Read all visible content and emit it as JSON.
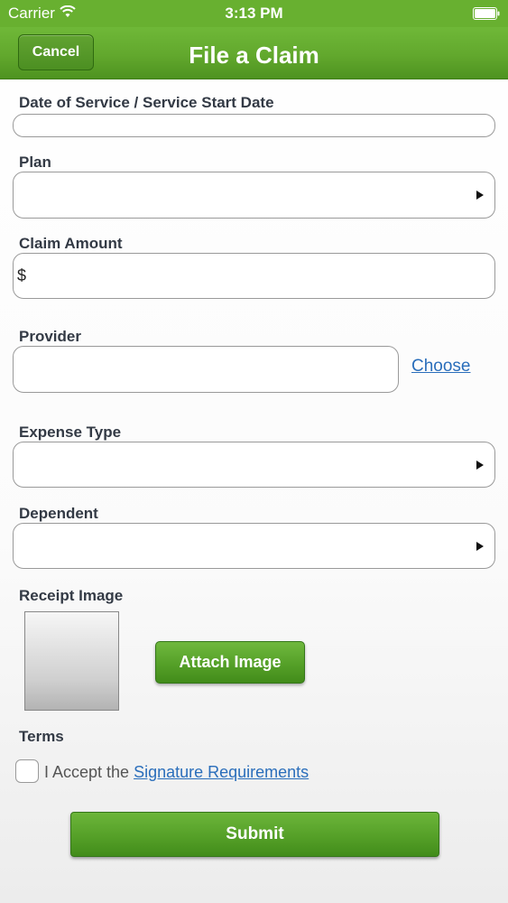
{
  "status_bar": {
    "carrier": "Carrier",
    "time": "3:13 PM",
    "wifi_icon": "wifi-icon",
    "battery_icon": "battery-icon"
  },
  "nav": {
    "cancel_label": "Cancel",
    "title": "File a Claim"
  },
  "form": {
    "date_label": "Date of Service / Service Start Date",
    "date_value": "",
    "plan_label": "Plan",
    "plan_value": "",
    "amount_label": "Claim Amount",
    "amount_prefix": "$",
    "amount_value": "",
    "provider_label": "Provider",
    "provider_value": "",
    "choose_label": "Choose",
    "expense_type_label": "Expense Type",
    "expense_type_value": "",
    "dependent_label": "Dependent",
    "dependent_value": "",
    "receipt_label": "Receipt Image",
    "attach_label": "Attach Image",
    "terms_label": "Terms",
    "terms_prefix": "I Accept the ",
    "terms_link": "Signature Requirements",
    "terms_checked": false,
    "submit_label": "Submit"
  },
  "colors": {
    "brand_green": "#62a82d",
    "link_blue": "#2a6ebb"
  }
}
